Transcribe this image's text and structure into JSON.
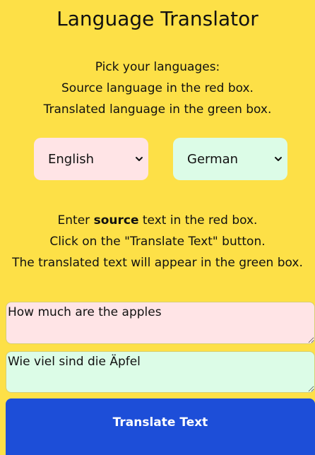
{
  "app": {
    "title": "Language Translator"
  },
  "intro": {
    "line1": "Pick your languages:",
    "line2": "Source language in the red box.",
    "line3": "Translated language in the green box."
  },
  "languages": {
    "source_selected": "English",
    "target_selected": "German"
  },
  "instructions": {
    "line1_prefix": "Enter ",
    "line1_bold": "source",
    "line1_suffix": " text in the red box.",
    "line2": "Click on the \"Translate Text\" button.",
    "line3": "The translated text will appear in the green box."
  },
  "source_text": "How much are the apples",
  "translated_text": "Wie viel sind die Äpfel",
  "translate_button": {
    "label": "Translate Text"
  },
  "colors": {
    "background": "#fde047",
    "source_box": "#ffe4e6",
    "target_box": "#dcfce7",
    "button": "#1d4ed8"
  },
  "icons": {
    "dropdown": "chevron-down-icon"
  }
}
